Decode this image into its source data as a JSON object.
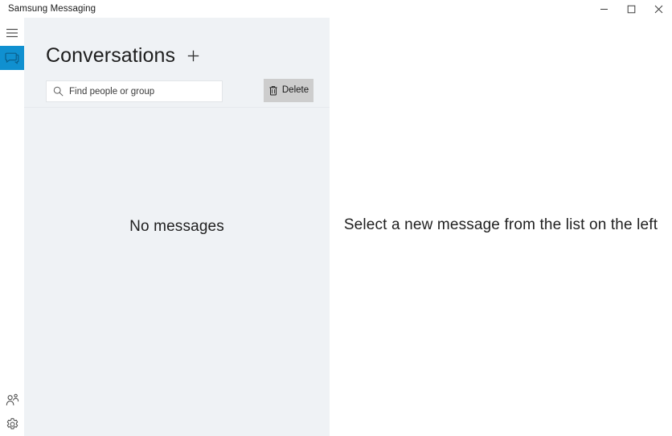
{
  "window": {
    "title": "Samsung Messaging",
    "controls": [
      {
        "name": "minimize",
        "glyph": "minimize-icon"
      },
      {
        "name": "maximize",
        "glyph": "maximize-icon"
      },
      {
        "name": "close",
        "glyph": "close-icon"
      }
    ]
  },
  "rail": {
    "items": [
      {
        "name": "menu",
        "icon": "hamburger-menu-icon",
        "selected": false
      },
      {
        "name": "messages",
        "icon": "message-bubble-icon",
        "selected": true
      },
      {
        "name": "contacts",
        "icon": "contacts-person-icon",
        "selected": false
      },
      {
        "name": "settings",
        "icon": "gear-icon",
        "selected": false
      }
    ],
    "accent_color": "#1090d0"
  },
  "list_panel": {
    "title": "Conversations",
    "new_conversation_icon": "plus-icon",
    "search": {
      "icon": "search-icon",
      "value": "",
      "placeholder": "Find people or group"
    },
    "delete_button": {
      "label": "Delete",
      "icon": "trash-icon"
    },
    "empty_state": "No messages",
    "background_color": "#eff2f5"
  },
  "detail_panel": {
    "empty_state": "Select a new message from the list on the left",
    "background_color": "#ffffff"
  }
}
